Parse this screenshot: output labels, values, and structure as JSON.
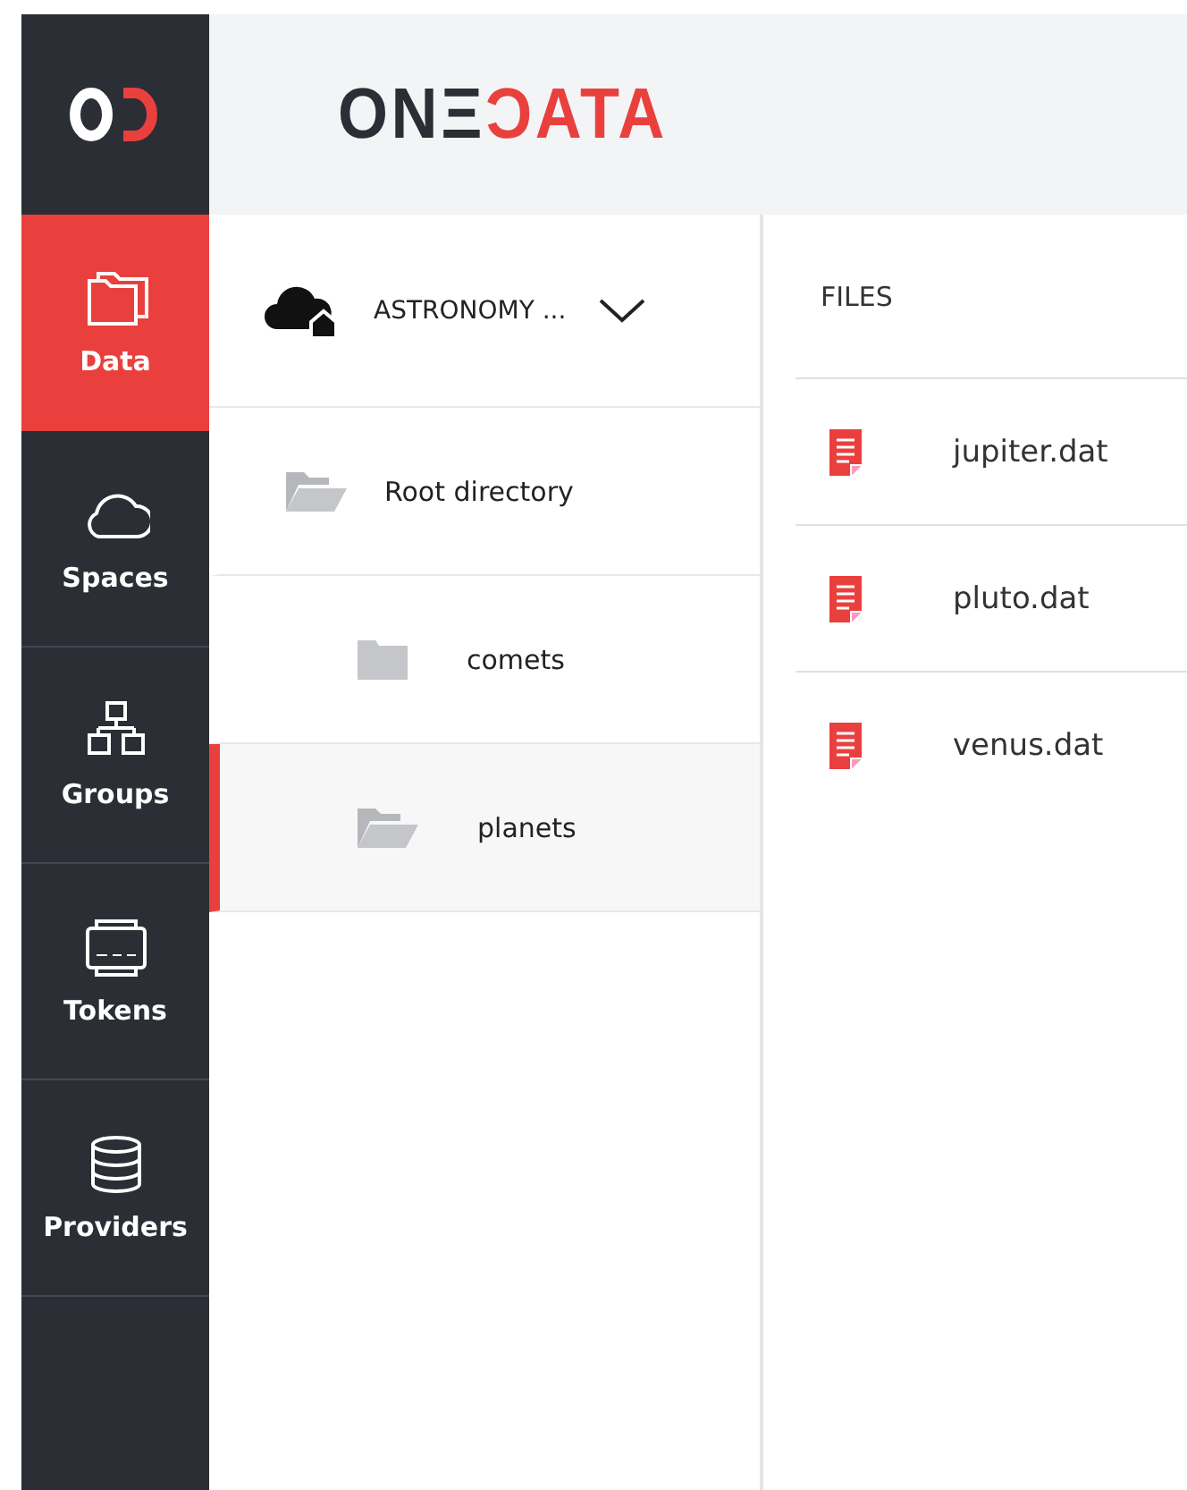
{
  "brand": {
    "part_1": "ONΞ",
    "part_2": "ƆATA"
  },
  "sidebar": {
    "items": [
      {
        "label": "Data",
        "kind": "data",
        "selected": true
      },
      {
        "label": "Spaces",
        "kind": "spaces",
        "selected": false
      },
      {
        "label": "Groups",
        "kind": "groups",
        "selected": false
      },
      {
        "label": "Tokens",
        "kind": "tokens",
        "selected": false
      },
      {
        "label": "Providers",
        "kind": "providers",
        "selected": false
      }
    ]
  },
  "space_selector": {
    "label": "ASTRONOMY ..."
  },
  "tree": [
    {
      "label": "Root directory",
      "selected": false,
      "children": [
        {
          "label": "comets",
          "selected": false
        },
        {
          "label": "planets",
          "selected": true
        }
      ]
    }
  ],
  "files": {
    "heading": "FILES",
    "rows": [
      {
        "name": "jupiter.dat"
      },
      {
        "name": "pluto.dat"
      },
      {
        "name": "venus.dat"
      }
    ]
  }
}
